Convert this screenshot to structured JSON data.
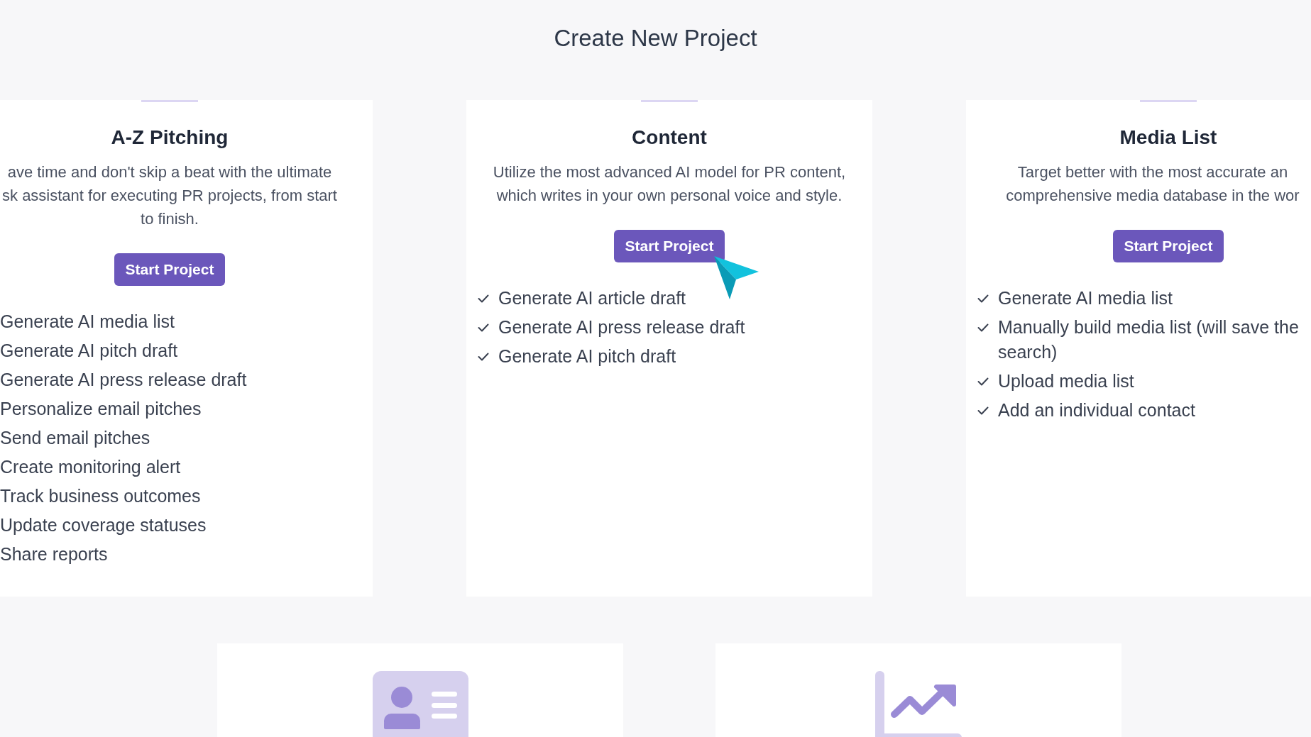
{
  "page": {
    "title": "Create New Project"
  },
  "cards": [
    {
      "title": "A-Z Pitching",
      "description_lines": [
        "ave time and don't skip a beat with the ultimate",
        "sk assistant for executing PR projects, from start",
        "to finish."
      ],
      "button": "Start Project",
      "features": [
        "Generate AI media list",
        "Generate AI pitch draft",
        "Generate AI press release draft",
        "Personalize email pitches",
        "Send email pitches",
        "Create monitoring alert",
        "Track business outcomes",
        "Update coverage statuses",
        "Share reports"
      ]
    },
    {
      "title": "Content",
      "description_lines": [
        "Utilize the most advanced AI model for PR content,",
        "which writes in your own personal voice and style."
      ],
      "button": "Start Project",
      "features": [
        "Generate AI article draft",
        "Generate AI press release draft",
        "Generate AI pitch draft"
      ]
    },
    {
      "title": "Media List",
      "description_lines": [
        "Target better with the most accurate an",
        "comprehensive media database in the wor"
      ],
      "button": "Start Project",
      "features": [
        "Generate AI media list",
        "Manually build media list (will save the search)",
        "Upload media list",
        "Add an individual contact"
      ]
    }
  ],
  "lower_cards": [
    {
      "kind": "profile"
    },
    {
      "kind": "trend"
    }
  ]
}
